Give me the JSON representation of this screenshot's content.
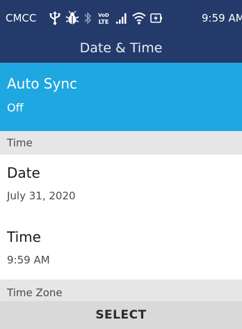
{
  "status_bar": {
    "carrier": "CMCC",
    "time": "9:59 AM",
    "icons": [
      "usb-icon",
      "bug-icon",
      "bluetooth-icon",
      "volte-lte-icon",
      "signal-icon",
      "wifi-icon",
      "battery-charging-icon"
    ],
    "volte_label": "VoLTE"
  },
  "header": {
    "title": "Date & Time"
  },
  "items": {
    "auto_sync": {
      "title": "Auto Sync",
      "value": "Off"
    },
    "date": {
      "title": "Date",
      "value": "July 31, 2020"
    },
    "time": {
      "title": "Time",
      "value": "9:59 AM"
    }
  },
  "sections": {
    "time": "Time",
    "time_zone": "Time Zone"
  },
  "softkey": {
    "center": "SELECT"
  },
  "colors": {
    "header_bg": "#243a6b",
    "selected_bg": "#1ea7e1",
    "section_bg": "#e6e6e6",
    "softkey_bg": "#d9d9d9"
  }
}
